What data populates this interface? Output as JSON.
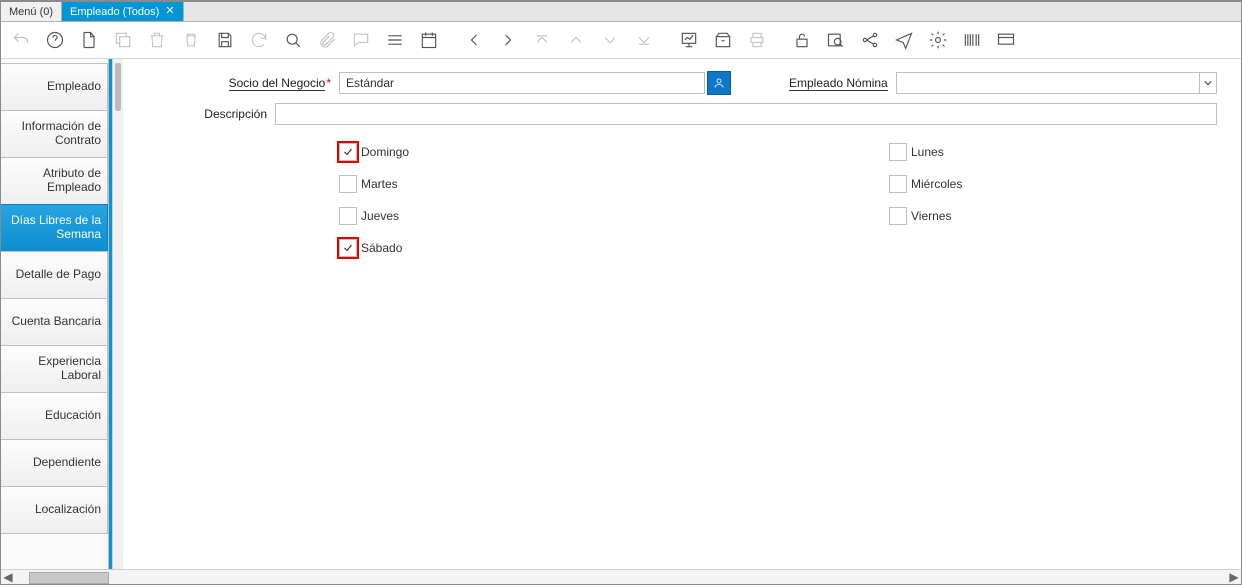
{
  "tabs": {
    "menu": "Menú (0)",
    "active": "Empleado (Todos)"
  },
  "toolbar_icons": [
    "undo",
    "help",
    "new",
    "copy",
    "delete",
    "delete-all",
    "save",
    "refresh",
    "search",
    "attach",
    "chat",
    "list",
    "calendar",
    "go-first",
    "go-prev",
    "close-up",
    "up",
    "down",
    "close-down",
    "widget",
    "inbox",
    "print",
    "lock",
    "folder-search",
    "workflow",
    "send",
    "settings",
    "barcode",
    "display"
  ],
  "sidetabs": [
    "Empleado",
    "Información de Contrato",
    "Atributo de Empleado",
    "Días Libres de la Semana",
    "Detalle de Pago",
    "Cuenta Bancaria",
    "Experiencia Laboral",
    "Educación",
    "Dependiente",
    "Localización"
  ],
  "active_sidetab_index": 3,
  "form": {
    "socio_label": "Socio del Negocio",
    "socio_value": "Estándar",
    "empleado_label": "Empleado Nómina",
    "empleado_value": "",
    "desc_label": "Descripción",
    "desc_value": ""
  },
  "days": [
    {
      "label": "Domingo",
      "checked": true,
      "highlight": true
    },
    {
      "label": "Lunes",
      "checked": false,
      "highlight": false
    },
    {
      "label": "Martes",
      "checked": false,
      "highlight": false
    },
    {
      "label": "Miércoles",
      "checked": false,
      "highlight": false
    },
    {
      "label": "Jueves",
      "checked": false,
      "highlight": false
    },
    {
      "label": "Viernes",
      "checked": false,
      "highlight": false
    },
    {
      "label": "Sábado",
      "checked": true,
      "highlight": true
    }
  ]
}
